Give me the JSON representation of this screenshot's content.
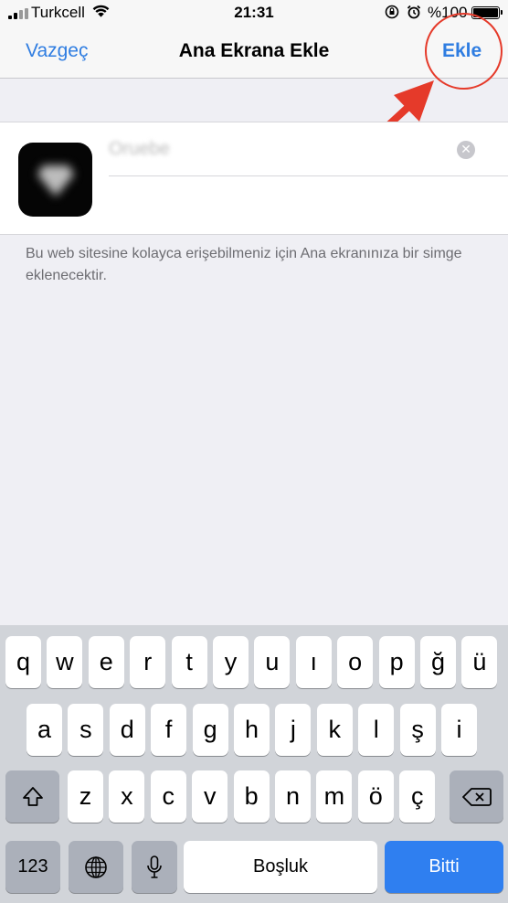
{
  "status_bar": {
    "carrier": "Turkcell",
    "time": "21:31",
    "battery_percent": "%100",
    "icons": [
      "signal-icon",
      "wifi-icon",
      "orientation-lock-icon",
      "alarm-icon",
      "battery-icon"
    ]
  },
  "nav": {
    "cancel_label": "Vazgeç",
    "title": "Ana Ekrana Ekle",
    "add_label": "Ekle"
  },
  "form": {
    "name_value": "Oruebe",
    "description": "Bu web sitesine kolayca erişebilmeniz için Ana ekranınıza bir simge eklenecektir."
  },
  "keyboard": {
    "row1": [
      "q",
      "w",
      "e",
      "r",
      "t",
      "y",
      "u",
      "ı",
      "o",
      "p",
      "ğ",
      "ü"
    ],
    "row2": [
      "a",
      "s",
      "d",
      "f",
      "g",
      "h",
      "j",
      "k",
      "l",
      "ş",
      "i"
    ],
    "row3": [
      "z",
      "x",
      "c",
      "v",
      "b",
      "n",
      "m",
      "ö",
      "ç"
    ],
    "numbers_label": "123",
    "space_label": "Boşluk",
    "done_label": "Bitti"
  },
  "colors": {
    "accent": "#2f7de1",
    "annotation": "#e53a2a",
    "done_key": "#2f7ff0"
  }
}
